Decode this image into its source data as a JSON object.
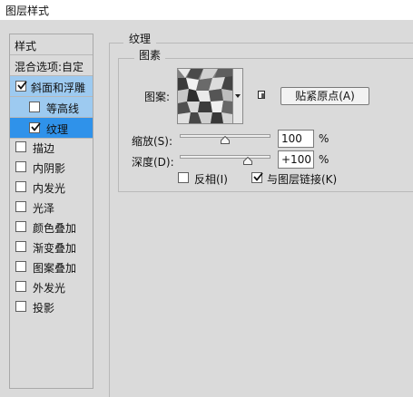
{
  "window": {
    "title": "图层样式"
  },
  "sidebar": {
    "styles_label": "样式",
    "blend_options_label": "混合选项:自定",
    "items": [
      {
        "label": "斜面和浮雕",
        "checked": true
      },
      {
        "label": "等高线",
        "checked": false
      },
      {
        "label": "纹理",
        "checked": true
      },
      {
        "label": "描边",
        "checked": false
      },
      {
        "label": "内阴影",
        "checked": false
      },
      {
        "label": "内发光",
        "checked": false
      },
      {
        "label": "光泽",
        "checked": false
      },
      {
        "label": "颜色叠加",
        "checked": false
      },
      {
        "label": "渐变叠加",
        "checked": false
      },
      {
        "label": "图案叠加",
        "checked": false
      },
      {
        "label": "外发光",
        "checked": false
      },
      {
        "label": "投影",
        "checked": false
      }
    ]
  },
  "texture": {
    "section_title": "纹理",
    "elements_title": "图素",
    "pattern_label": "图案:",
    "snap_origin_button": "贴紧原点(A)",
    "scale_label": "缩放(S):",
    "scale_value": "100",
    "scale_unit": "%",
    "scale_level": 0.5,
    "depth_label": "深度(D):",
    "depth_value": "+100",
    "depth_unit": "%",
    "depth_level": 0.75,
    "invert_label": "反相(I)",
    "invert_checked": false,
    "link_label": "与图层链接(K)",
    "link_checked": true
  },
  "colors": {
    "selected_light": "#9dcaf0",
    "selected_blue": "#2f92ea",
    "background": "#dadada"
  }
}
